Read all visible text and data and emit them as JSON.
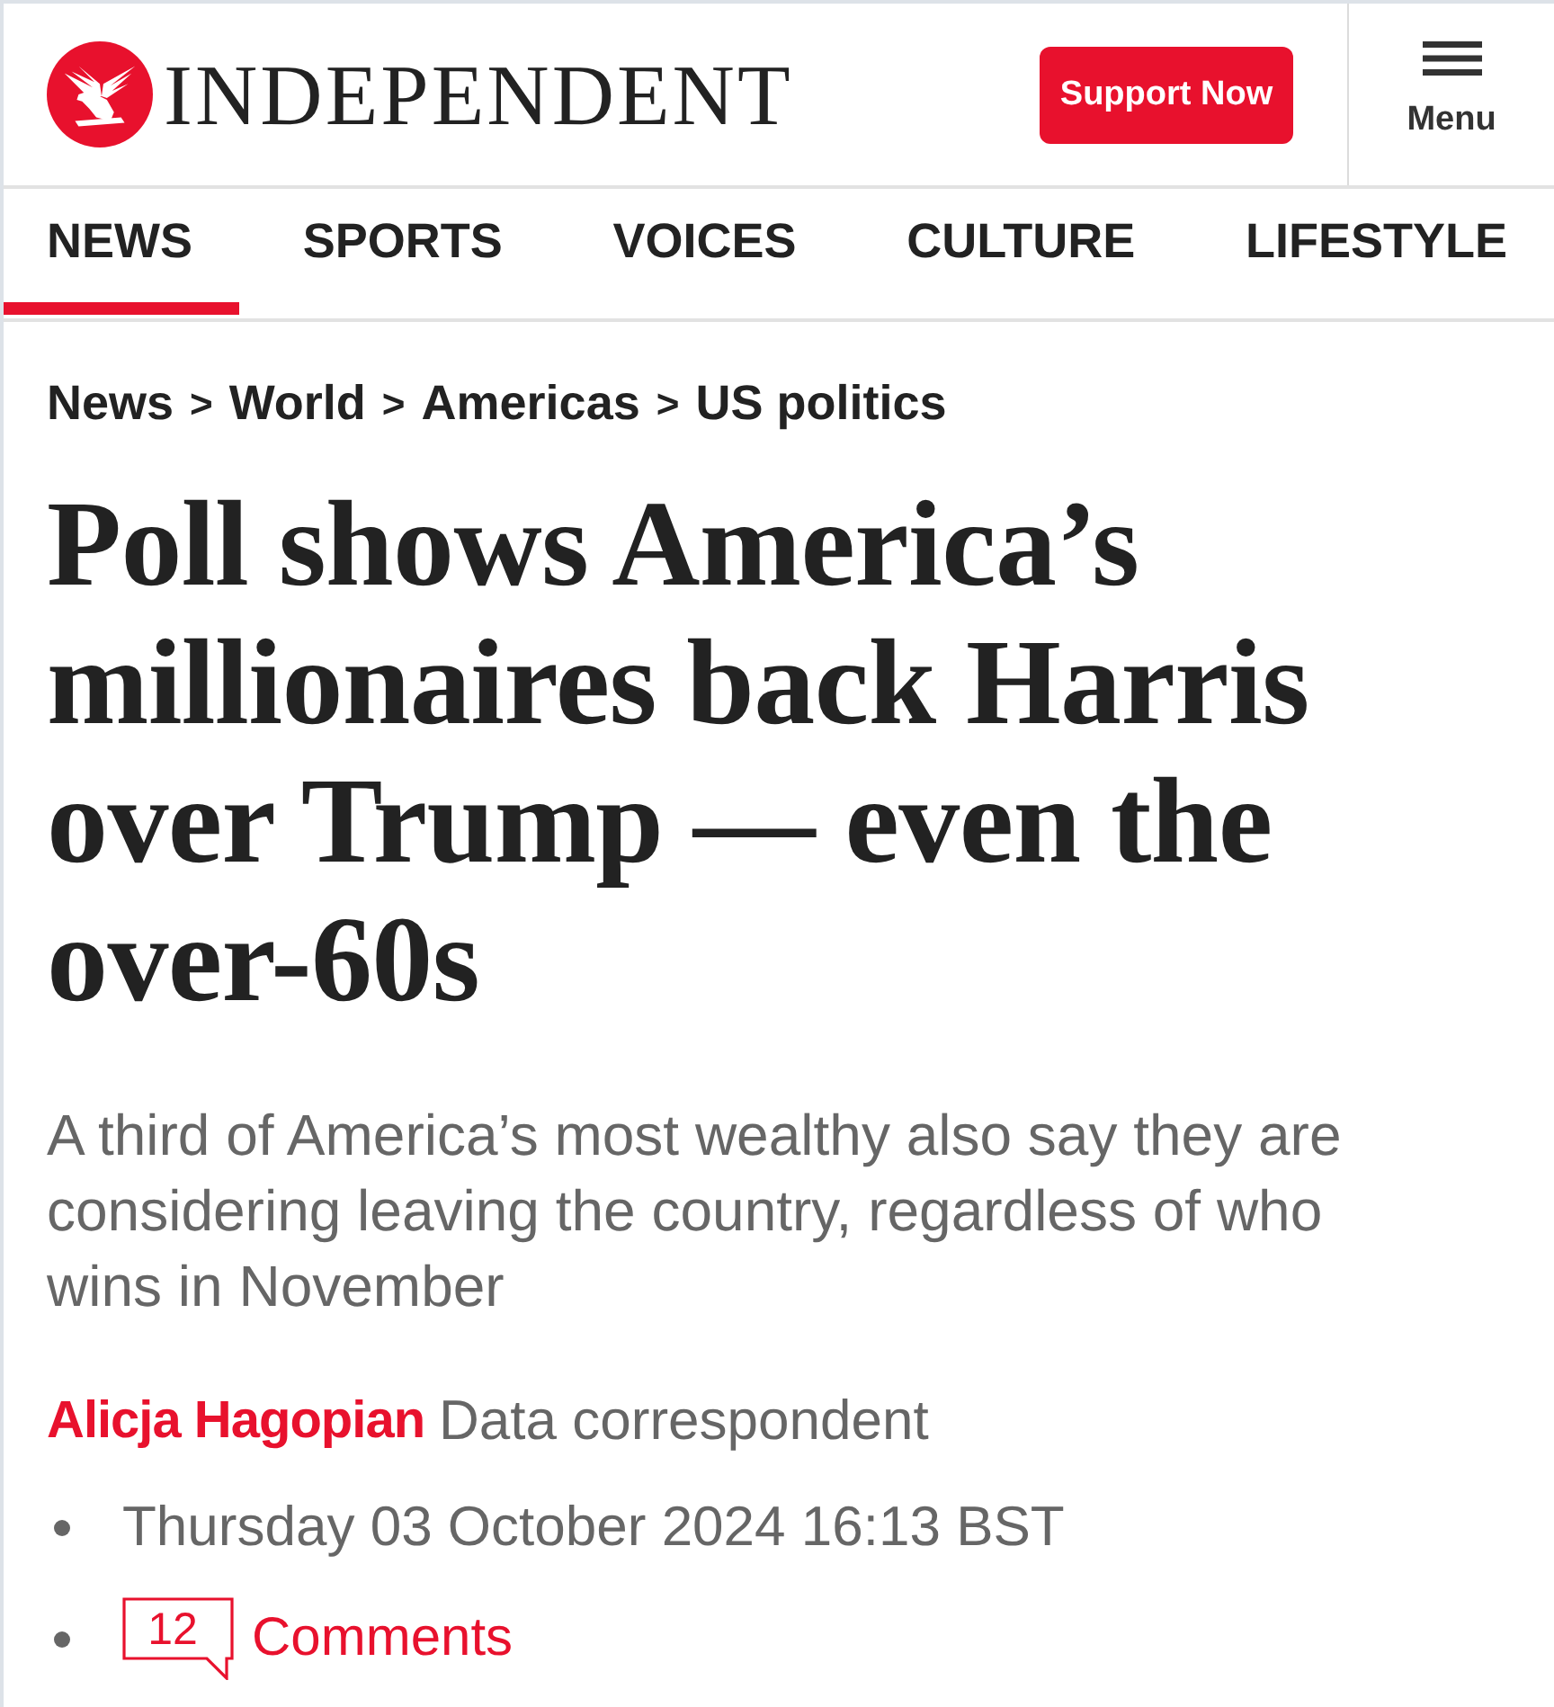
{
  "header": {
    "logo_text": "INDEPENDENT",
    "support_button": "Support Now",
    "menu_label": "Menu"
  },
  "nav": [
    {
      "label": "NEWS",
      "selected": true
    },
    {
      "label": "SPORTS",
      "selected": false
    },
    {
      "label": "VOICES",
      "selected": false
    },
    {
      "label": "CULTURE",
      "selected": false
    },
    {
      "label": "LIFESTYLE",
      "selected": false
    }
  ],
  "breadcrumb": {
    "separator": ">",
    "items": [
      "News",
      "World",
      "Americas",
      "US politics"
    ]
  },
  "headline": "Poll shows America’s millionaires back Harris over Trump — even the over-60s",
  "standfirst": "A third of America’s most wealthy also say they are considering leaving the country, regardless of who wins in November",
  "byline": {
    "author": "Alicja Hagopian",
    "role": "Data correspondent"
  },
  "meta": [
    {
      "kind": "date",
      "text": "Thursday 03 October 2024 16:13 BST"
    },
    {
      "kind": "comments",
      "count": "12",
      "label": "Comments"
    }
  ]
}
